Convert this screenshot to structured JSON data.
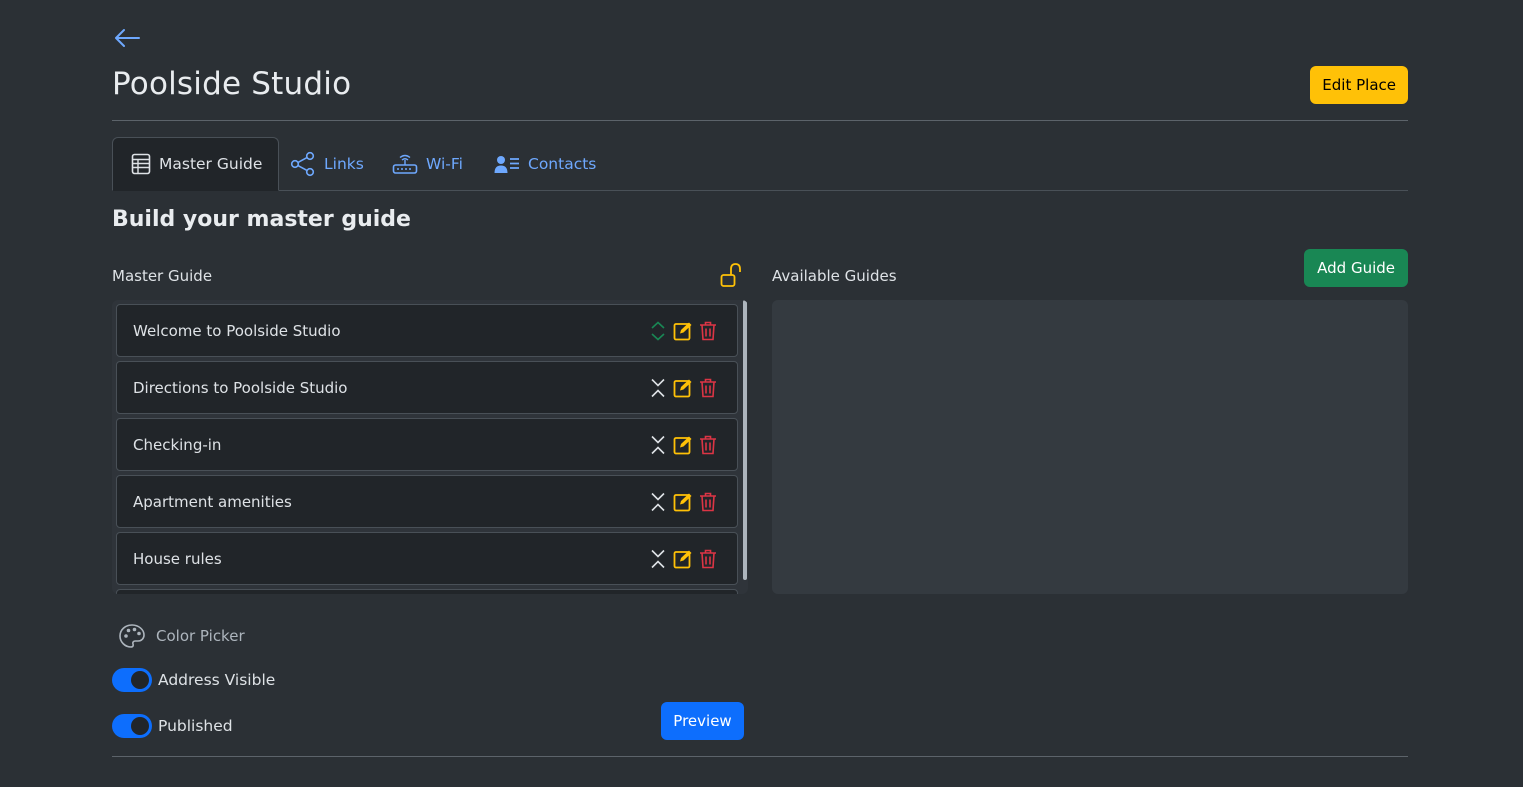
{
  "header": {
    "title": "Poolside Studio",
    "edit_label": "Edit Place"
  },
  "tabs": [
    {
      "label": "Master Guide",
      "icon": "table-icon",
      "active": true
    },
    {
      "label": "Links",
      "icon": "share-icon",
      "active": false
    },
    {
      "label": "Wi-Fi",
      "icon": "router-icon",
      "active": false
    },
    {
      "label": "Contacts",
      "icon": "contacts-icon",
      "active": false
    }
  ],
  "section": {
    "title": "Build your master guide",
    "master_label": "Master Guide",
    "available_label": "Available Guides",
    "add_label": "Add Guide"
  },
  "master_items": [
    {
      "label": "Welcome to Poolside Studio",
      "move_icon": "collapse-arrows-icon"
    },
    {
      "label": "Directions to Poolside Studio",
      "move_icon": "expand-arrows-icon"
    },
    {
      "label": "Checking-in",
      "move_icon": "expand-arrows-icon"
    },
    {
      "label": "Apartment amenities",
      "move_icon": "expand-arrows-icon"
    },
    {
      "label": "House rules",
      "move_icon": "expand-arrows-icon"
    }
  ],
  "settings": {
    "color_picker_label": "Color Picker",
    "address_visible_label": "Address Visible",
    "address_visible": true,
    "published_label": "Published",
    "published": true,
    "preview_label": "Preview"
  },
  "colors": {
    "accent": "#6ea8fe",
    "warning": "#ffc107",
    "success": "#198754",
    "danger": "#dc3545",
    "primary": "#0d6efd"
  }
}
